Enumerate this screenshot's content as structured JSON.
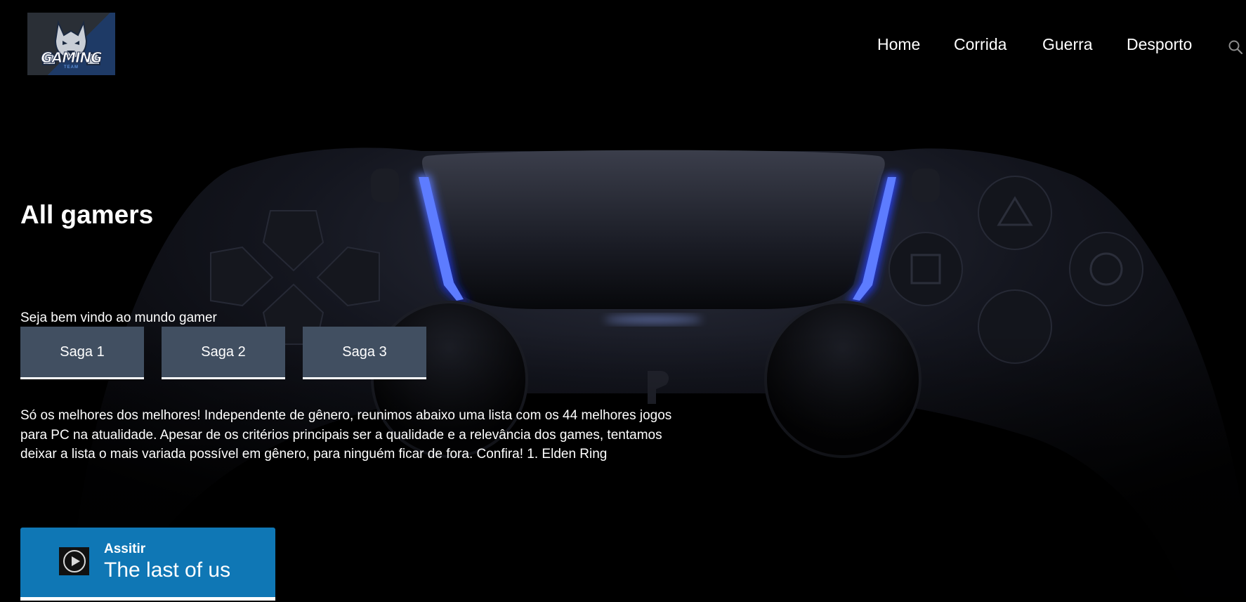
{
  "header": {
    "logo": {
      "text": "GAMING",
      "subtext": "TEAM"
    },
    "nav": [
      {
        "label": "Home"
      },
      {
        "label": "Corrida"
      },
      {
        "label": "Guerra"
      },
      {
        "label": "Desporto"
      }
    ],
    "search_icon": "search-icon"
  },
  "hero": {
    "title": "All gamers",
    "welcome": "Seja bem vindo ao mundo gamer",
    "sagas": [
      {
        "label": "Saga 1"
      },
      {
        "label": "Saga 2"
      },
      {
        "label": "Saga 3"
      }
    ],
    "description": "Só os melhores dos melhores! Independente de gênero, reunimos abaixo uma lista com os 44 melhores jogos para PC na atualidade. Apesar de os critérios principais ser a qualidade e a relevância dos games, tentamos deixar a lista o mais variada possível em gênero, para ninguém ficar de fora. Confira! 1. Elden Ring",
    "watch": {
      "label": "Assitir",
      "title": "The last of us",
      "icon": "play-icon"
    }
  },
  "colors": {
    "background": "#000000",
    "saga_button": "#414f61",
    "watch_card": "#0f77b5",
    "controller_light": "#2f5bff"
  }
}
